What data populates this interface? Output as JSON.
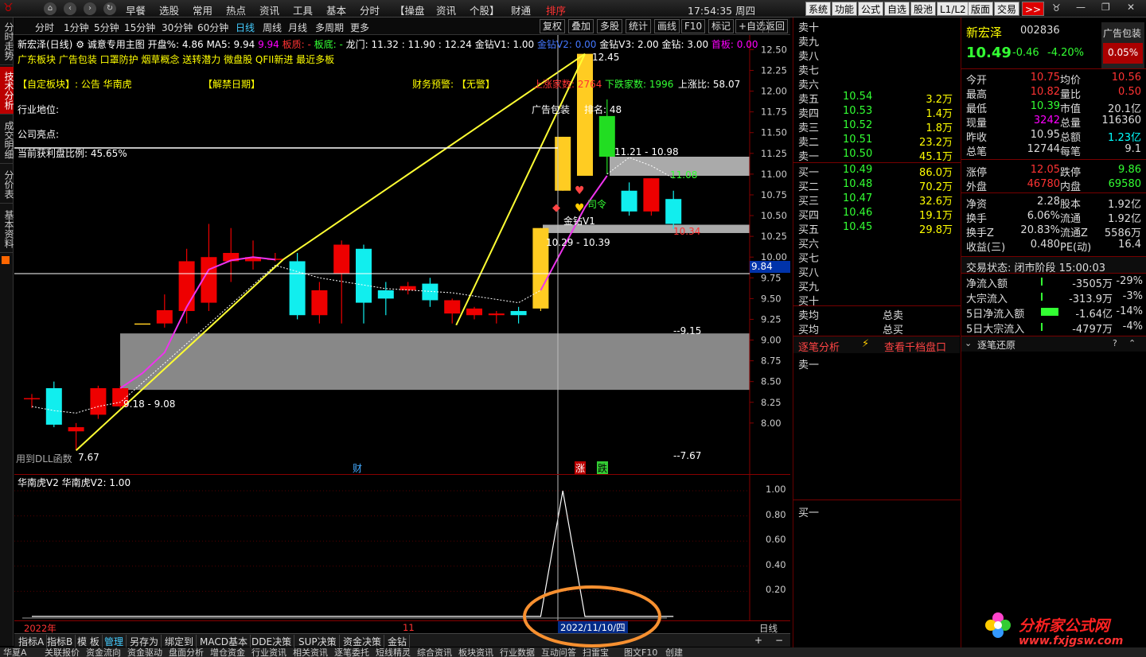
{
  "menu": {
    "items": [
      "早餐",
      "选股",
      "常用",
      "热点",
      "资讯",
      "工具",
      "基本",
      "分时",
      "【操盘",
      "资讯",
      "个股】",
      "财通",
      "排序"
    ],
    "clock": "17:54:35 周四",
    "right_buttons": [
      "系统",
      "功能",
      "公式",
      "自选",
      "股池",
      "L1/L2",
      "版面",
      "交易",
      ">>"
    ]
  },
  "left_tabs": [
    "分时走势",
    "技术分析",
    "成交明细",
    "分价表",
    "基本资料"
  ],
  "periods": [
    "分时",
    "1分钟",
    "5分钟",
    "15分钟",
    "30分钟",
    "60分钟",
    "日线",
    "周线",
    "月线",
    "多周期",
    "更多"
  ],
  "period_active": "日线",
  "tools": [
    "复权",
    "叠加",
    "多股",
    "统计",
    "画线",
    "F10",
    "标记",
    "+自选",
    "返回"
  ],
  "info": {
    "row1_name": "新宏泽(日线)",
    "row1_main": "诚意专用主图",
    "row1_open": "开盘%: 4.86",
    "row1_ma5": "MA5: 9.94",
    "row1_val": "9.94",
    "row1_bd": "板质: -",
    "row1_bottom": "板底: -",
    "row1_dragon": "龙门: 11.32 : 11.90 : 12.24",
    "row1_jz1": "金钻V1: 1.00",
    "row1_jz2": "金钻V2: 0.00",
    "row1_jz3": "金钻V3: 2.00",
    "row1_jz": "金钻: 3.00",
    "row1_ban": "首板: 0.00",
    "row2": "广东板块  广告包装  口罩防护  烟草概念  送转潜力  微盘股  QFII新进  最近多板",
    "row3_block": "【自定板块】: 公告 华南虎",
    "row3_unlock": "【解禁日期】",
    "row3_warn": "财务预警: 【无警】",
    "row3_up": "上涨家数: 2764",
    "row3_down": "下跌家数: 1996",
    "row3_ratio": "上涨比: 58.07",
    "row4": "行业地位:",
    "row4_ad": "广告包装",
    "row4_rank": "排名: 48",
    "row5": "公司亮点:",
    "row6": "当前获利盘比例: 45.65%"
  },
  "annotations": {
    "high": "12.45",
    "range1": "11.21 - 10.98",
    "val11": "11.08",
    "jz_v1": "金钻V1",
    "command": "司令",
    "range2": "10.29 - 10.39",
    "low1": "10.34",
    "level915": "--9.15",
    "range3": "9.18 - 9.08",
    "level767": "--7.67",
    "dll": "用到DLL函数",
    "low767": "7.67",
    "marker_cai": "财",
    "marker_zhang": "涨",
    "marker_die": "跌",
    "current_price": "9.84"
  },
  "price_axis": [
    "12.50",
    "12.25",
    "12.00",
    "11.75",
    "11.50",
    "11.25",
    "11.00",
    "10.75",
    "10.50",
    "10.25",
    "10.00",
    "9.75",
    "9.50",
    "9.25",
    "9.00",
    "8.75",
    "8.50",
    "8.25",
    "8.00"
  ],
  "sub": {
    "title": "华南虎V2  华南虎V2: 1.00",
    "axis": [
      "1.00",
      "0.80",
      "0.60",
      "0.40",
      "0.20"
    ]
  },
  "dates": {
    "year": "2022年",
    "month": "11",
    "cursor": "2022/11/10/四",
    "period": "日线"
  },
  "indicators": [
    "指标A",
    "指标B",
    "模 板",
    "管理",
    "另存为",
    "绑定到",
    "MACD基本",
    "DDE决策",
    "SUP决策",
    "资金决策",
    "金钻"
  ],
  "bottom": [
    "华夏A",
    "关联报价",
    "资金流向",
    "资金驱动",
    "盘面分析",
    "增仓资金",
    "行业资讯",
    "相关资讯",
    "逐笔委托",
    "短线精灵",
    "综合资讯",
    "板块资讯",
    "行业数据",
    "互动问答",
    "扫雷宝",
    "图文F10",
    "创建"
  ],
  "book": {
    "sells": [
      {
        "label": "卖十",
        "price": "",
        "vol": ""
      },
      {
        "label": "卖九",
        "price": "",
        "vol": ""
      },
      {
        "label": "卖八",
        "price": "",
        "vol": ""
      },
      {
        "label": "卖七",
        "price": "",
        "vol": ""
      },
      {
        "label": "卖六",
        "price": "",
        "vol": ""
      },
      {
        "label": "卖五",
        "price": "10.54",
        "vol": "3.2万"
      },
      {
        "label": "卖四",
        "price": "10.53",
        "vol": "1.4万"
      },
      {
        "label": "卖三",
        "price": "10.52",
        "vol": "1.8万"
      },
      {
        "label": "卖二",
        "price": "10.51",
        "vol": "23.2万"
      },
      {
        "label": "卖一",
        "price": "10.50",
        "vol": "45.1万"
      }
    ],
    "buys": [
      {
        "label": "买一",
        "price": "10.49",
        "vol": "86.0万"
      },
      {
        "label": "买二",
        "price": "10.48",
        "vol": "70.2万"
      },
      {
        "label": "买三",
        "price": "10.47",
        "vol": "32.6万"
      },
      {
        "label": "买四",
        "price": "10.46",
        "vol": "19.1万"
      },
      {
        "label": "买五",
        "price": "10.45",
        "vol": "29.8万"
      },
      {
        "label": "买六",
        "price": "",
        "vol": ""
      },
      {
        "label": "买七",
        "price": "",
        "vol": ""
      },
      {
        "label": "买八",
        "price": "",
        "vol": ""
      },
      {
        "label": "买九",
        "price": "",
        "vol": ""
      },
      {
        "label": "买十",
        "price": "",
        "vol": ""
      }
    ],
    "avg_sell": "卖均",
    "total_sell": "总卖",
    "avg_buy": "买均",
    "total_buy": "总买",
    "tick_label": "逐笔分析",
    "tick_link": "查看千档盘口",
    "ask_one": "卖一",
    "bid_one": "买一"
  },
  "quote": {
    "name": "新宏泽",
    "code": "002836",
    "tag": "广告包装",
    "price": "10.49",
    "change": "-0.46",
    "pct": "-4.20%",
    "tag_pct": "0.05%",
    "rows": [
      [
        "今开",
        "10.75",
        "均价",
        "10.56"
      ],
      [
        "最高",
        "10.82",
        "量比",
        "0.50"
      ],
      [
        "最低",
        "10.39",
        "市值",
        "20.1亿"
      ],
      [
        "现量",
        "3242",
        "总量",
        "116360"
      ],
      [
        "昨收",
        "10.95",
        "总额",
        "1.23亿"
      ],
      [
        "总笔",
        "12744",
        "每笔",
        "9.1"
      ]
    ],
    "rows2": [
      [
        "涨停",
        "12.05",
        "跌停",
        "9.86"
      ],
      [
        "外盘",
        "46780",
        "内盘",
        "69580"
      ]
    ],
    "rows3": [
      [
        "净资",
        "2.28",
        "股本",
        "1.92亿"
      ],
      [
        "换手",
        "6.06%",
        "流通",
        "1.92亿"
      ],
      [
        "换手Z",
        "20.83%",
        "流通Z",
        "5586万"
      ],
      [
        "收益(三)",
        "0.480",
        "PE(动)",
        "16.4"
      ]
    ],
    "status": "交易状态: 闭市阶段 15:00:03",
    "flows": [
      {
        "label": "净流入额",
        "value": "-3505万",
        "pct": "-29%",
        "bar": 0.06
      },
      {
        "label": "大宗流入",
        "value": "-313.9万",
        "pct": "-3%",
        "bar": 0.01
      },
      {
        "label": "5日净流入额",
        "value": "-1.64亿",
        "pct": "-14%",
        "bar": 0.55
      },
      {
        "label": "5日大宗流入",
        "value": "-4797万",
        "pct": "-4%",
        "bar": 0.05
      }
    ],
    "tick_restore": "逐笔还原",
    "watermark": "分析家公式网",
    "watermark_url": "www.fxjgsw.com"
  },
  "chart_data": {
    "type": "candlestick",
    "ylim": [
      7.5,
      12.6
    ],
    "candles": [
      {
        "o": 8.3,
        "c": 8.3,
        "h": 8.35,
        "l": 8.18,
        "color": "red"
      },
      {
        "o": 8.42,
        "c": 7.98,
        "h": 8.5,
        "l": 7.95,
        "color": "cyan"
      },
      {
        "o": 7.95,
        "c": 7.9,
        "h": 8.0,
        "l": 7.67,
        "color": "red"
      },
      {
        "o": 8.1,
        "c": 8.42,
        "h": 8.45,
        "l": 8.05,
        "color": "red"
      },
      {
        "o": 8.2,
        "c": 8.42,
        "h": 8.45,
        "l": 8.18,
        "color": "red"
      },
      {
        "o": 9.2,
        "c": 9.2,
        "h": 9.2,
        "l": 9.2,
        "color": "yellow"
      },
      {
        "o": 9.2,
        "c": 9.36,
        "h": 9.55,
        "l": 9.15,
        "color": "red"
      },
      {
        "o": 9.35,
        "c": 9.95,
        "h": 10.1,
        "l": 9.2,
        "color": "red"
      },
      {
        "o": 9.45,
        "c": 10.0,
        "h": 10.4,
        "l": 9.35,
        "color": "red"
      },
      {
        "o": 9.95,
        "c": 10.05,
        "h": 10.35,
        "l": 9.7,
        "color": "red"
      },
      {
        "o": 9.95,
        "c": 10.0,
        "h": 10.2,
        "l": 9.85,
        "color": "red"
      },
      {
        "o": 9.98,
        "c": 9.97,
        "h": 10.05,
        "l": 9.95,
        "color": "red"
      },
      {
        "o": 9.95,
        "c": 9.3,
        "h": 10.05,
        "l": 9.25,
        "color": "cyan"
      },
      {
        "o": 9.3,
        "c": 9.6,
        "h": 9.7,
        "l": 9.2,
        "color": "red"
      },
      {
        "o": 9.8,
        "c": 10.15,
        "h": 10.2,
        "l": 9.2,
        "color": "red"
      },
      {
        "o": 10.1,
        "c": 9.45,
        "h": 10.15,
        "l": 9.2,
        "color": "cyan"
      },
      {
        "o": 9.6,
        "c": 9.5,
        "h": 9.7,
        "l": 9.3,
        "color": "cyan"
      },
      {
        "o": 9.6,
        "c": 9.65,
        "h": 9.7,
        "l": 9.55,
        "color": "red"
      },
      {
        "o": 9.68,
        "c": 9.48,
        "h": 9.75,
        "l": 9.4,
        "color": "cyan"
      },
      {
        "o": 9.48,
        "c": 9.32,
        "h": 9.5,
        "l": 9.2,
        "color": "red"
      },
      {
        "o": 9.38,
        "c": 9.3,
        "h": 9.4,
        "l": 9.25,
        "color": "red"
      },
      {
        "o": 9.32,
        "c": 9.3,
        "h": 9.35,
        "l": 9.2,
        "color": "red"
      },
      {
        "o": 9.35,
        "c": 9.3,
        "h": 9.4,
        "l": 9.2,
        "color": "cyan"
      },
      {
        "o": 9.38,
        "c": 10.35,
        "h": 10.35,
        "l": 9.35,
        "color": "yellow"
      },
      {
        "o": 10.8,
        "c": 11.45,
        "h": 11.45,
        "l": 10.8,
        "color": "yellow"
      },
      {
        "o": 10.98,
        "c": 12.45,
        "h": 12.45,
        "l": 10.98,
        "color": "yellow"
      },
      {
        "o": 11.21,
        "c": 11.7,
        "h": 11.9,
        "l": 11.0,
        "color": "green"
      },
      {
        "o": 10.8,
        "c": 10.55,
        "h": 10.9,
        "l": 10.5,
        "color": "cyan"
      },
      {
        "o": 10.95,
        "c": 10.55,
        "h": 10.95,
        "l": 10.5,
        "color": "red"
      },
      {
        "o": 10.7,
        "c": 10.4,
        "h": 10.8,
        "l": 10.34,
        "color": "cyan"
      }
    ],
    "sub_values": [
      0,
      0,
      0,
      0,
      0,
      0,
      0,
      0,
      0,
      0,
      0,
      0,
      0,
      0,
      0,
      0,
      0,
      0,
      0,
      0,
      0,
      0,
      0,
      0,
      1,
      0,
      0,
      0,
      0,
      0
    ]
  }
}
